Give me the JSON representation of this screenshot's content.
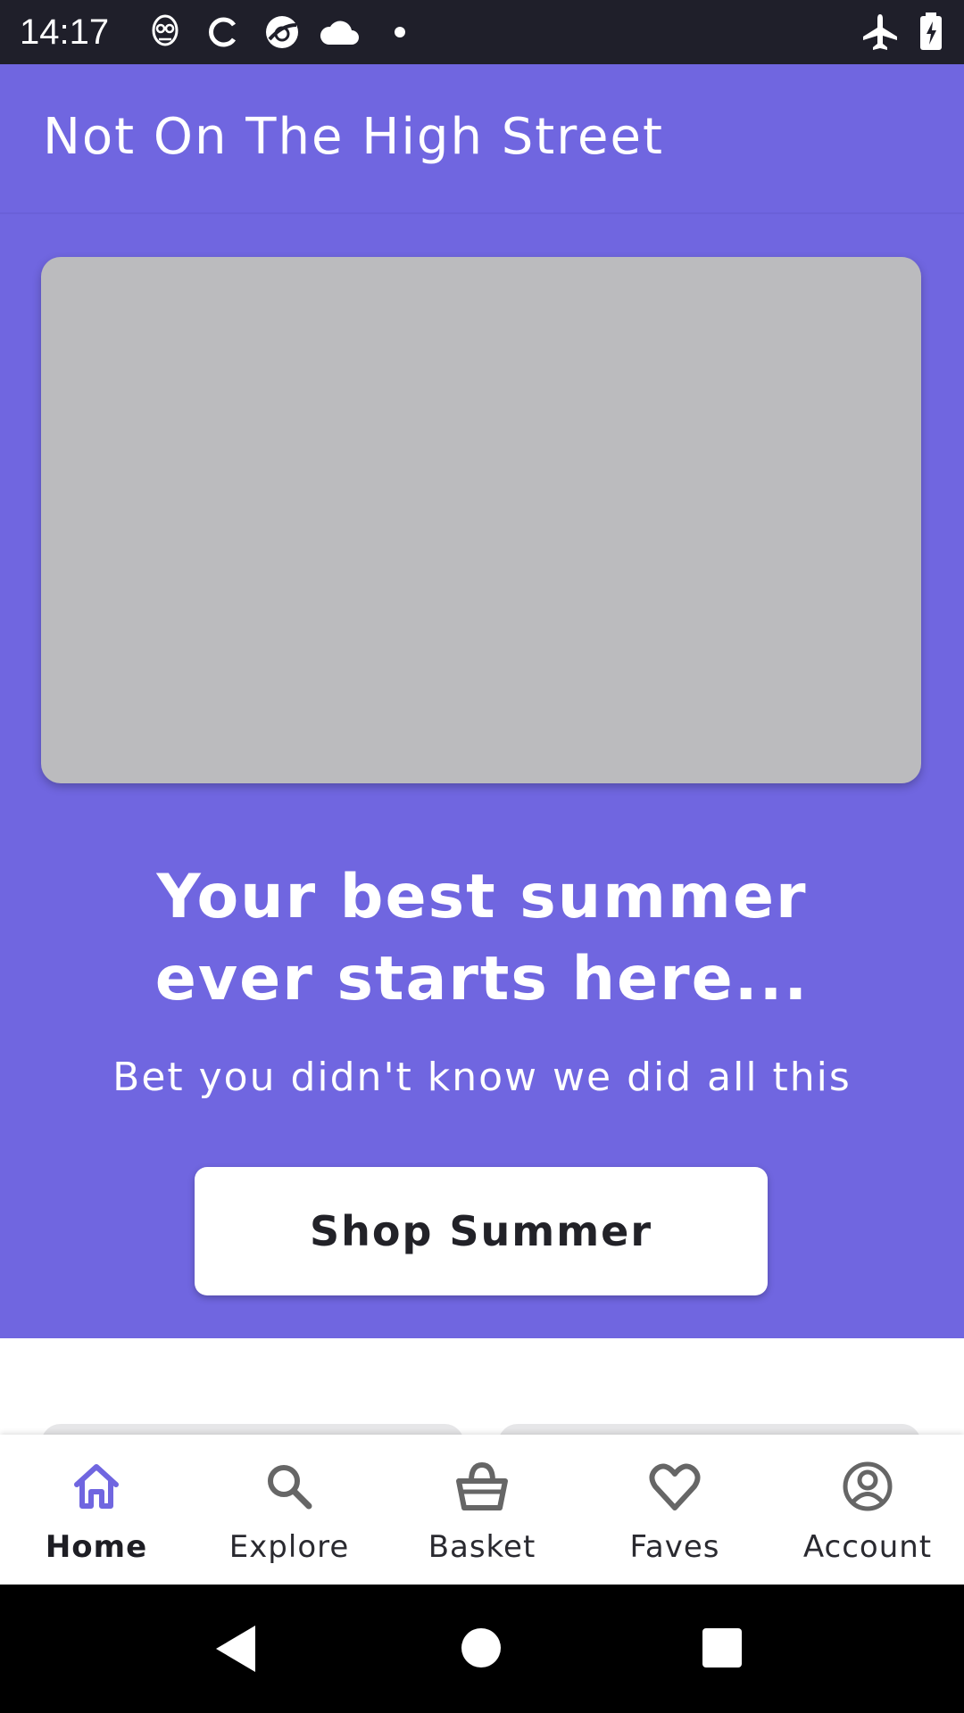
{
  "status_bar": {
    "time": "14:17",
    "icons": [
      "face-mask-icon",
      "sync-icon",
      "globe-icon",
      "cloud-icon",
      "dot-icon"
    ],
    "right_icons": [
      "airplane-icon",
      "battery-charging-icon"
    ]
  },
  "app_bar": {
    "title": "Not On The High Street"
  },
  "hero": {
    "heading_line1": "Your best summer",
    "heading_line2": "ever starts here...",
    "subheading": "Bet you didn't know we did all this",
    "cta_label": "Shop Summer"
  },
  "bottom_nav": {
    "items": [
      {
        "label": "Home",
        "icon": "home-icon",
        "active": true
      },
      {
        "label": "Explore",
        "icon": "search-icon",
        "active": false
      },
      {
        "label": "Basket",
        "icon": "basket-icon",
        "active": false
      },
      {
        "label": "Faves",
        "icon": "heart-icon",
        "active": false
      },
      {
        "label": "Account",
        "icon": "account-icon",
        "active": false
      }
    ]
  },
  "colors": {
    "brand": "#7066e0",
    "status_bar": "#1f1f2a",
    "placeholder": "#bbbbbe",
    "nav_active": "#7066e0",
    "nav_inactive": "#666666"
  }
}
